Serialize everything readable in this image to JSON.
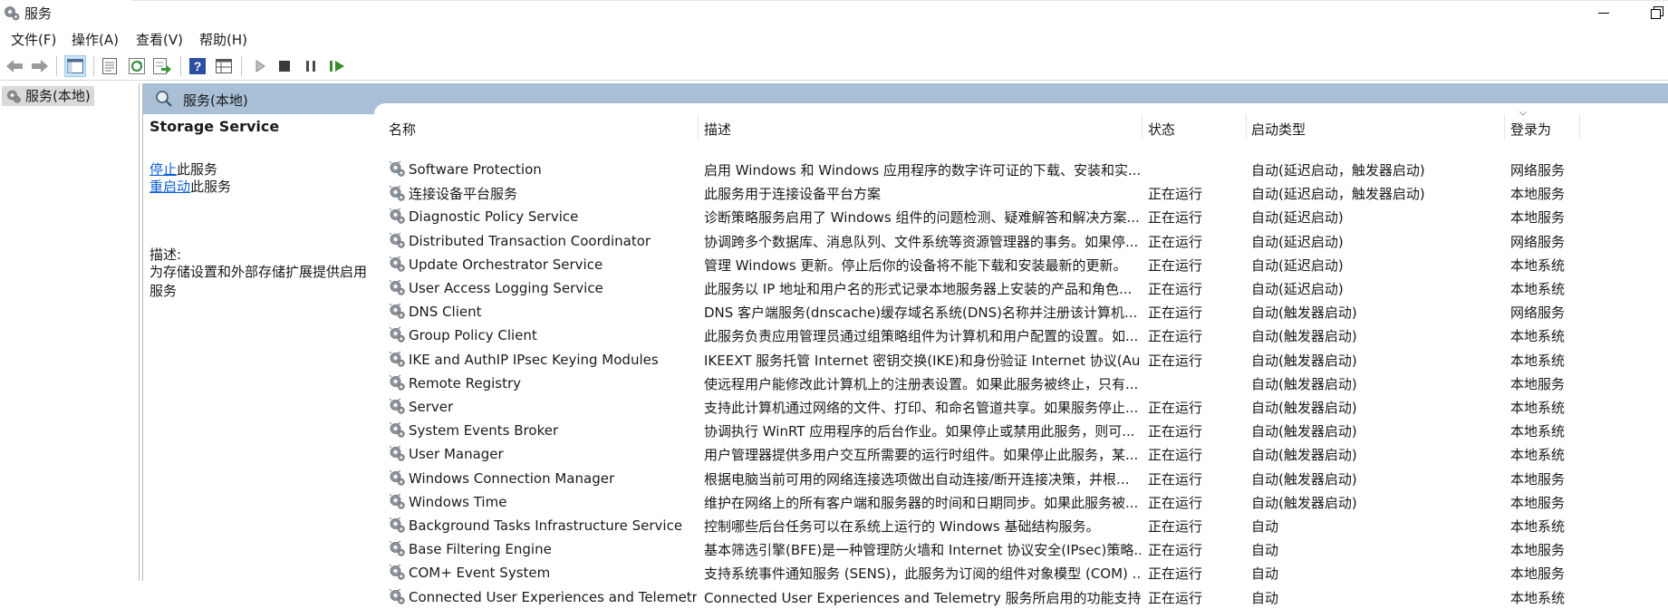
{
  "window": {
    "title": "服务",
    "icon": "services-gear-icon"
  },
  "menu": [
    "文件(F)",
    "操作(A)",
    "查看(V)",
    "帮助(H)"
  ],
  "toolbar": {
    "buttons": [
      "back-arrow-icon",
      "forward-arrow-icon",
      "console-tree-icon",
      "properties-icon",
      "refresh-icon",
      "export-list-icon",
      "help-icon",
      "view-icon",
      "start-service-icon",
      "stop-service-icon",
      "pause-service-icon",
      "resume-service-icon"
    ]
  },
  "tree": {
    "root_label": "服务(本地)"
  },
  "pane": {
    "header": "服务(本地)",
    "selected_service": "Storage Service",
    "actions": [
      {
        "link": "停止",
        "suffix": "此服务"
      },
      {
        "link": "重启动",
        "suffix": "此服务"
      }
    ],
    "description_label": "描述:",
    "description": "为存储设置和外部存储扩展提供启用服务"
  },
  "list": {
    "columns": [
      "名称",
      "描述",
      "状态",
      "启动类型",
      "登录为"
    ],
    "rows": [
      [
        "Software Protection",
        "启用 Windows 和 Windows 应用程序的数字许可证的下载、安装和实...",
        "",
        "自动(延迟启动，触发器启动)",
        "网络服务"
      ],
      [
        "连接设备平台服务",
        "此服务用于连接设备平台方案",
        "正在运行",
        "自动(延迟启动，触发器启动)",
        "本地服务"
      ],
      [
        "Diagnostic Policy Service",
        "诊断策略服务启用了 Windows 组件的问题检测、疑难解答和解决方案...",
        "正在运行",
        "自动(延迟启动)",
        "本地服务"
      ],
      [
        "Distributed Transaction Coordinator",
        "协调跨多个数据库、消息队列、文件系统等资源管理器的事务。如果停...",
        "正在运行",
        "自动(延迟启动)",
        "网络服务"
      ],
      [
        "Update Orchestrator Service",
        "管理 Windows 更新。停止后你的设备将不能下载和安装最新的更新。",
        "正在运行",
        "自动(延迟启动)",
        "本地系统"
      ],
      [
        "User Access Logging Service",
        "此服务以 IP 地址和用户名的形式记录本地服务器上安装的产品和角色...",
        "正在运行",
        "自动(延迟启动)",
        "本地系统"
      ],
      [
        "DNS Client",
        "DNS 客户端服务(dnscache)缓存域名系统(DNS)名称并注册该计算机...",
        "正在运行",
        "自动(触发器启动)",
        "网络服务"
      ],
      [
        "Group Policy Client",
        "此服务负责应用管理员通过组策略组件为计算机和用户配置的设置。如...",
        "正在运行",
        "自动(触发器启动)",
        "本地系统"
      ],
      [
        "IKE and AuthIP IPsec Keying Modules",
        "IKEEXT 服务托管 Internet 密钥交换(IKE)和身份验证 Internet 协议(Auth...",
        "正在运行",
        "自动(触发器启动)",
        "本地系统"
      ],
      [
        "Remote Registry",
        "使远程用户能修改此计算机上的注册表设置。如果此服务被终止，只有...",
        "",
        "自动(触发器启动)",
        "本地服务"
      ],
      [
        "Server",
        "支持此计算机通过网络的文件、打印、和命名管道共享。如果服务停止...",
        "正在运行",
        "自动(触发器启动)",
        "本地系统"
      ],
      [
        "System Events Broker",
        "协调执行 WinRT 应用程序的后台作业。如果停止或禁用此服务，则可...",
        "正在运行",
        "自动(触发器启动)",
        "本地系统"
      ],
      [
        "User Manager",
        "用户管理器提供多用户交互所需要的运行时组件。如果停止此服务，某...",
        "正在运行",
        "自动(触发器启动)",
        "本地系统"
      ],
      [
        "Windows Connection Manager",
        "根据电脑当前可用的网络连接选项做出自动连接/断开连接决策，并根...",
        "正在运行",
        "自动(触发器启动)",
        "本地服务"
      ],
      [
        "Windows Time",
        "维护在网络上的所有客户端和服务器的时间和日期同步。如果此服务被...",
        "正在运行",
        "自动(触发器启动)",
        "本地服务"
      ],
      [
        "Background Tasks Infrastructure Service",
        "控制哪些后台任务可以在系统上运行的 Windows 基础结构服务。",
        "正在运行",
        "自动",
        "本地系统"
      ],
      [
        "Base Filtering Engine",
        "基本筛选引擎(BFE)是一种管理防火墙和 Internet 协议安全(IPsec)策略...",
        "正在运行",
        "自动",
        "本地服务"
      ],
      [
        "COM+ Event System",
        "支持系统事件通知服务 (SENS)，此服务为订阅的组件对象模型 (COM) ...",
        "正在运行",
        "自动",
        "本地服务"
      ],
      [
        "Connected User Experiences and Telemetry",
        "Connected User Experiences and Telemetry 服务所启用的功能支持...",
        "正在运行",
        "自动",
        "本地系统"
      ]
    ]
  }
}
